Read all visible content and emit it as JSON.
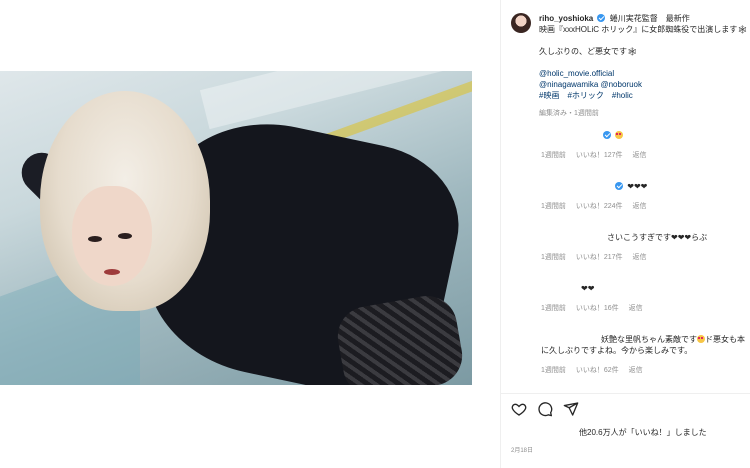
{
  "post": {
    "username": "riho_yoshioka",
    "caption_line1_suffix": "蜷川実花監督　最新作",
    "caption_line2": "映画『xxxHOLiC ホリック』に女郎蜘蛛役で出演します🕸",
    "caption_line3": "久しぶりの、ど悪女です🕸",
    "tags_line1": "@holic_movie.official",
    "tags_line2": "@ninagawamika @noboruok",
    "tags_line3": "#映画　#ホリック　#holic",
    "edited_meta": "編集済み・1週間前"
  },
  "comments": [
    {
      "text": "",
      "emoji": "heart-eyes",
      "time": "1週間前",
      "likes": "いいね！127件",
      "reply": "返信"
    },
    {
      "text": "❤❤❤",
      "time": "1週間前",
      "likes": "いいね！224件",
      "reply": "返信"
    },
    {
      "text": "さいこうすぎです❤❤❤らぶ",
      "time": "1週間前",
      "likes": "いいね！217件",
      "reply": "返信"
    },
    {
      "text": "❤❤",
      "time": "1週間前",
      "likes": "いいね！16件",
      "reply": "返信"
    },
    {
      "text_a": "妖艶な里帆ちゃん素敵です",
      "text_b": "ド悪女も本",
      "text_line2": "に久しぶりですよね。今から楽しみです。",
      "time": "1週間前",
      "likes": "いいね！62件",
      "reply": "返信"
    }
  ],
  "likes_summary": "他20.6万人が「いいね！」しました",
  "date": "2月18日",
  "icons": {
    "like": "heart-icon",
    "comment": "comment-icon",
    "share": "share-icon"
  },
  "colors": {
    "verified": "#3897f0",
    "link": "#00376b",
    "meta": "#8e8e8e"
  }
}
